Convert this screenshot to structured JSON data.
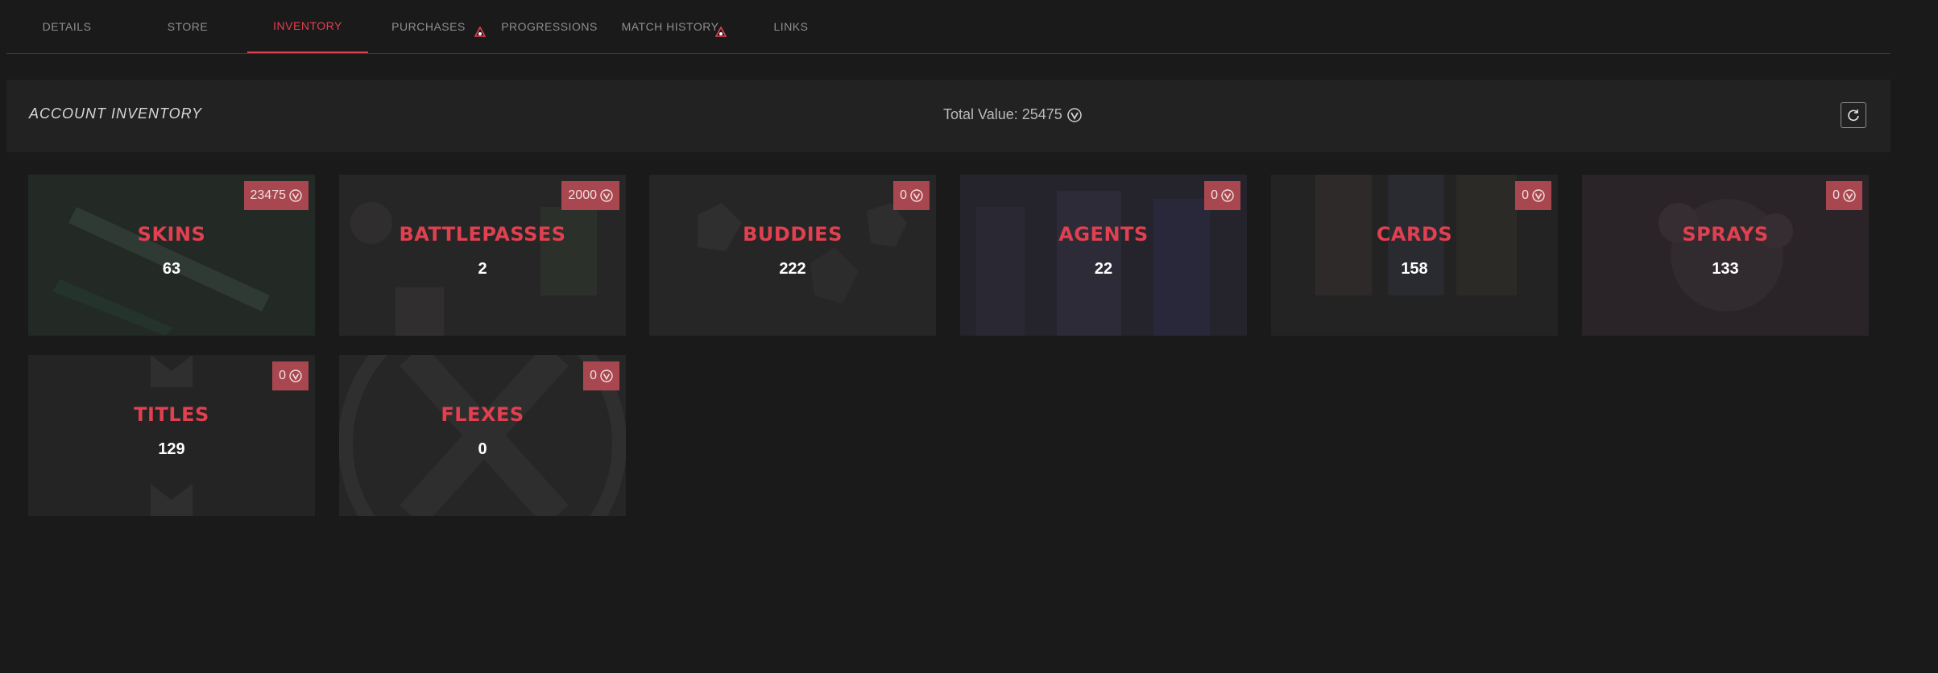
{
  "tabs": [
    {
      "label": "DETAILS",
      "active": false,
      "badge": false
    },
    {
      "label": "STORE",
      "active": false,
      "badge": false
    },
    {
      "label": "INVENTORY",
      "active": true,
      "badge": false
    },
    {
      "label": "PURCHASES",
      "active": false,
      "badge": true
    },
    {
      "label": "PROGRESSIONS",
      "active": false,
      "badge": false
    },
    {
      "label": "MATCH HISTORY",
      "active": false,
      "badge": true
    },
    {
      "label": "LINKS",
      "active": false,
      "badge": false
    }
  ],
  "inventory": {
    "title": "ACCOUNT INVENTORY",
    "total_label": "Total Value: 25475",
    "refresh_icon": "refresh-icon"
  },
  "cards": [
    {
      "name": "SKINS",
      "count": "63",
      "value": "23475"
    },
    {
      "name": "BATTLEPASSES",
      "count": "2",
      "value": "2000"
    },
    {
      "name": "BUDDIES",
      "count": "222",
      "value": "0"
    },
    {
      "name": "AGENTS",
      "count": "22",
      "value": "0"
    },
    {
      "name": "CARDS",
      "count": "158",
      "value": "0"
    },
    {
      "name": "SPRAYS",
      "count": "133",
      "value": "0"
    },
    {
      "name": "TITLES",
      "count": "129",
      "value": "0"
    },
    {
      "name": "FLEXES",
      "count": "0",
      "value": "0"
    }
  ],
  "colors": {
    "background": "#1b1a1b",
    "panel": "#232223",
    "accent": "#e0404f",
    "value_badge": "#a8474f"
  }
}
